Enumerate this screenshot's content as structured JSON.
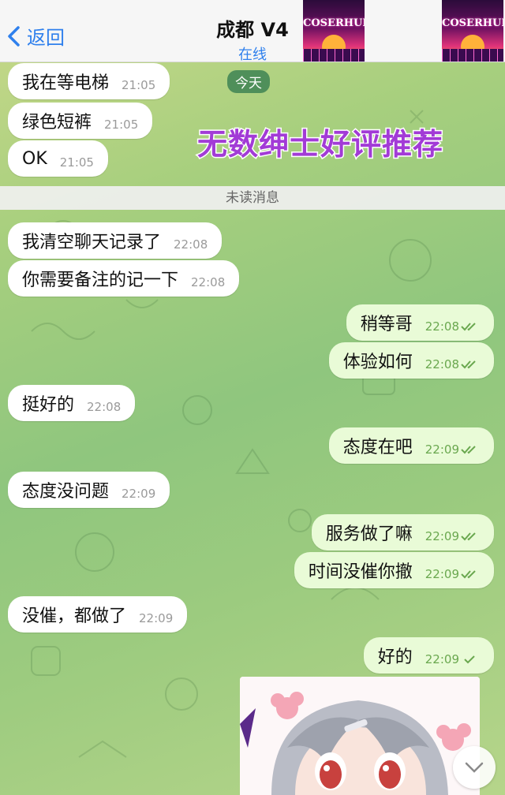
{
  "header": {
    "back_label": "返回",
    "title": "成都 V4",
    "status": "在线",
    "logo_text": "COSERHUB"
  },
  "date_badge": "今天",
  "promo_text": "无数绅士好评推荐",
  "unread_label": "未读消息",
  "messages": [
    {
      "dir": "in",
      "text": "我在等电梯",
      "time": "21:05"
    },
    {
      "dir": "in",
      "text": "绿色短裤",
      "time": "21:05"
    },
    {
      "dir": "in",
      "text": "OK",
      "time": "21:05"
    },
    {
      "dir": "in",
      "text": "我清空聊天记录了",
      "time": "22:08"
    },
    {
      "dir": "in",
      "text": "你需要备注的记一下",
      "time": "22:08"
    },
    {
      "dir": "out",
      "text": "稍等哥",
      "time": "22:08",
      "read": true
    },
    {
      "dir": "out",
      "text": "体验如何",
      "time": "22:08",
      "read": true
    },
    {
      "dir": "in",
      "text": "挺好的",
      "time": "22:08"
    },
    {
      "dir": "out",
      "text": "态度在吧",
      "time": "22:09",
      "read": true
    },
    {
      "dir": "in",
      "text": "态度没问题",
      "time": "22:09"
    },
    {
      "dir": "out",
      "text": "服务做了嘛",
      "time": "22:09",
      "read": true
    },
    {
      "dir": "out",
      "text": "时间没催你撤",
      "time": "22:09",
      "read": true
    },
    {
      "dir": "in",
      "text": "没催，都做了",
      "time": "22:09"
    },
    {
      "dir": "out",
      "text": "好的",
      "time": "22:09",
      "read": false
    }
  ],
  "colors": {
    "accent": "#2f80ed",
    "incoming_bubble": "#ffffff",
    "outgoing_bubble": "#e9fbd7",
    "outgoing_time": "#6aa84f",
    "promo": "#a23bd6"
  }
}
